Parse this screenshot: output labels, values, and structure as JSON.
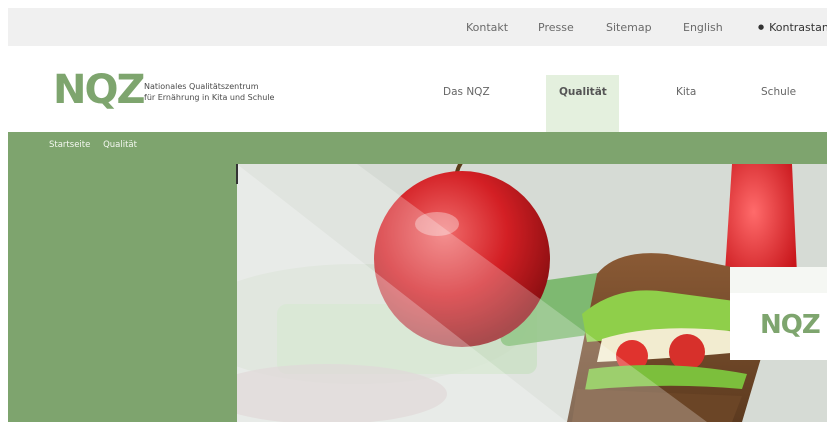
{
  "topnav": {
    "links": [
      "Kontakt",
      "Presse",
      "Sitemap",
      "English"
    ],
    "contrast_label": "Kontrastansicht"
  },
  "logo": {
    "mark": "NQZ",
    "line1": "Nationales Qualitätszentrum",
    "line2": "für Ernährung in Kita und Schule"
  },
  "mainnav": {
    "items": [
      "Das NQZ",
      "Qualität",
      "Kita",
      "Schule"
    ],
    "active": "Qualität"
  },
  "breadcrumb": {
    "items": [
      "Startseite",
      "Qualität"
    ]
  },
  "hero": {
    "card_logo": "NQZ"
  },
  "colors": {
    "brand_green": "#7ea46e",
    "active_nav_bg": "#e4f0de",
    "topbar_bg": "#f0f0f0"
  }
}
